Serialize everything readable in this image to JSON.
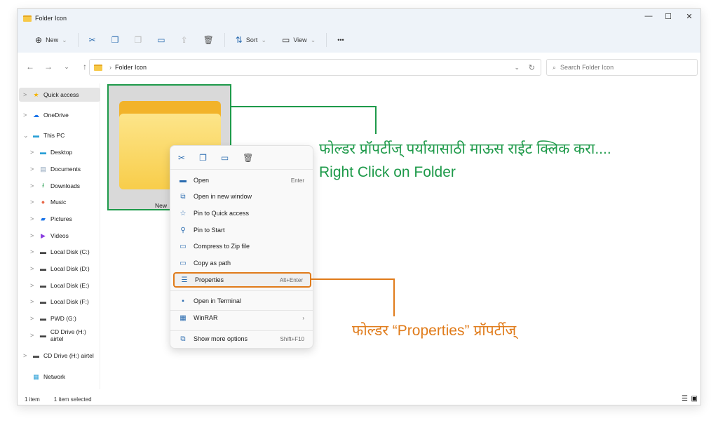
{
  "window": {
    "title": "Folder Icon",
    "controls": [
      "—",
      "☐",
      "✕"
    ]
  },
  "toolbar": {
    "new": "New",
    "sort": "Sort",
    "view": "View",
    "more": "•••"
  },
  "address": {
    "path": "Folder Icon",
    "search_placeholder": "Search Folder Icon"
  },
  "sidebar": {
    "items": [
      {
        "label": "Quick access",
        "icon": "★",
        "color": "#f4b400",
        "indent": 0,
        "chev": ">",
        "selected": true
      },
      {
        "label": "OneDrive",
        "icon": "☁",
        "color": "#1a73e8",
        "indent": 0,
        "chev": ">"
      },
      {
        "label": "This PC",
        "icon": "▬",
        "color": "#2a9fd6",
        "indent": 0,
        "chev": "⌄"
      },
      {
        "label": "Desktop",
        "icon": "▬",
        "color": "#2a9fd6",
        "indent": 1,
        "chev": ">"
      },
      {
        "label": "Documents",
        "icon": "▤",
        "color": "#8aa0b8",
        "indent": 1,
        "chev": ">"
      },
      {
        "label": "Downloads",
        "icon": "⭳",
        "color": "#1e9a4a",
        "indent": 1,
        "chev": ">"
      },
      {
        "label": "Music",
        "icon": "●",
        "color": "#e8684a",
        "indent": 1,
        "chev": ">"
      },
      {
        "label": "Pictures",
        "icon": "▰",
        "color": "#1a73e8",
        "indent": 1,
        "chev": ">"
      },
      {
        "label": "Videos",
        "icon": "▶",
        "color": "#8a3ee0",
        "indent": 1,
        "chev": ">"
      },
      {
        "label": "Local Disk (C:)",
        "icon": "▬",
        "color": "#444",
        "indent": 1,
        "chev": ">"
      },
      {
        "label": "Local Disk (D:)",
        "icon": "▬",
        "color": "#444",
        "indent": 1,
        "chev": ">"
      },
      {
        "label": "Local Disk (E:)",
        "icon": "▬",
        "color": "#444",
        "indent": 1,
        "chev": ">"
      },
      {
        "label": "Local Disk (F:)",
        "icon": "▬",
        "color": "#444",
        "indent": 1,
        "chev": ">"
      },
      {
        "label": "PWD (G:)",
        "icon": "▬",
        "color": "#444",
        "indent": 1,
        "chev": ">"
      },
      {
        "label": "CD Drive (H:) airtel",
        "icon": "▬",
        "color": "#444",
        "indent": 1,
        "chev": ">"
      },
      {
        "label": "CD Drive (H:) airtel",
        "icon": "▬",
        "color": "#444",
        "indent": 0,
        "chev": ">"
      },
      {
        "label": "Network",
        "icon": "▦",
        "color": "#2a9fd6",
        "indent": 0,
        "chev": ""
      }
    ]
  },
  "status": {
    "count": "1 item",
    "selected": "1 item selected"
  },
  "folder": {
    "label": "New"
  },
  "context_menu": {
    "items": [
      {
        "label": "Open",
        "shortcut": "Enter",
        "icon": "folder-open-icon",
        "glyph": "▬"
      },
      {
        "label": "Open in new window",
        "shortcut": "",
        "icon": "external-window-icon",
        "glyph": "⧉"
      },
      {
        "label": "Pin to Quick access",
        "shortcut": "",
        "icon": "star-icon",
        "glyph": "☆"
      },
      {
        "label": "Pin to Start",
        "shortcut": "",
        "icon": "pin-icon",
        "glyph": "⚲"
      },
      {
        "label": "Compress to Zip file",
        "shortcut": "",
        "icon": "zip-icon",
        "glyph": "▭"
      },
      {
        "label": "Copy as path",
        "shortcut": "",
        "icon": "path-icon",
        "glyph": "▭"
      },
      {
        "label": "Properties",
        "shortcut": "Alt+Enter",
        "icon": "properties-icon",
        "glyph": "☰",
        "highlight": true
      },
      {
        "label": "Open in Terminal",
        "shortcut": "",
        "icon": "terminal-icon",
        "glyph": "▪"
      },
      {
        "label": "WinRAR",
        "shortcut": "›",
        "icon": "winrar-icon",
        "glyph": "▦"
      },
      {
        "label": "Show more options",
        "shortcut": "Shift+F10",
        "icon": "more-options-icon",
        "glyph": "⧉"
      }
    ]
  },
  "annotations": {
    "marathi_top": "फोल्डर प्रॉपर्टीज् पर्यायासाठी माऊस राईट क्लिक करा....",
    "english_top": "Right Click on Folder",
    "marathi_bottom": "फोल्डर “Properties” प्रॉपर्टीज्",
    "green": "#1e9a4a",
    "orange": "#e07b1a"
  }
}
